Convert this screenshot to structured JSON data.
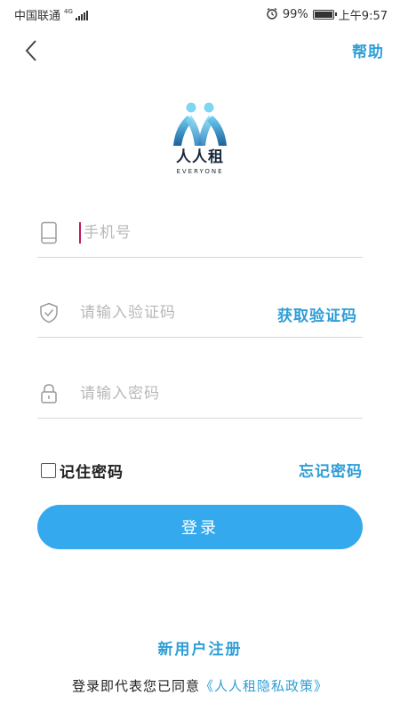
{
  "status_bar": {
    "carrier": "中国联通",
    "network_type": "4G",
    "battery_percent_label": "99%",
    "battery_level": 0.99,
    "time": "上午9:57"
  },
  "nav": {
    "back_icon": "chevron-left-icon",
    "help_label": "帮助"
  },
  "logo": {
    "name_cn": "人人租",
    "name_en": "EVERYONE"
  },
  "form": {
    "phone": {
      "icon": "phone-icon",
      "placeholder": "手机号",
      "value": ""
    },
    "code": {
      "icon": "shield-check-icon",
      "placeholder": "请输入验证码",
      "value": "",
      "get_code_label": "获取验证码"
    },
    "password": {
      "icon": "lock-icon",
      "placeholder": "请输入密码",
      "value": ""
    },
    "remember_label": "记住密码",
    "remember_checked": false,
    "forgot_label": "忘记密码",
    "login_label": "登录"
  },
  "footer": {
    "register_label": "新用户注册",
    "agreement_prefix": "登录即代表您已同意",
    "policy_label": "《人人租隐私政策》"
  },
  "colors": {
    "accent": "#2e9ed6",
    "button": "#34a9ee",
    "caret": "#c2185b"
  }
}
